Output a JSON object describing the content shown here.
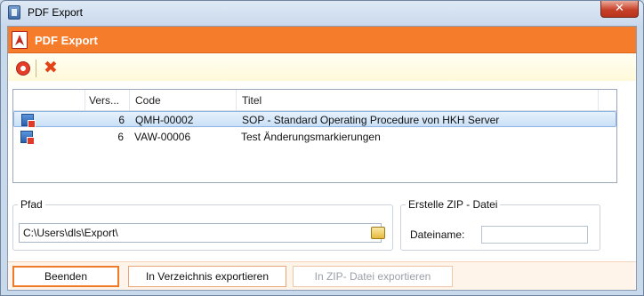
{
  "window": {
    "title": "PDF Export",
    "close_glyph": "✕"
  },
  "header": {
    "title": "PDF Export"
  },
  "toolbar": {
    "help_icon": "help-lifebuoy-icon",
    "cancel_icon": "red-x-icon",
    "cancel_glyph": "✖"
  },
  "grid": {
    "columns": [
      "Vers...",
      "Code",
      "Titel"
    ],
    "rows": [
      {
        "version": "6",
        "code": "QMH-00002",
        "title": "SOP - Standard Operating Procedure von HKH Server",
        "selected": true
      },
      {
        "version": "6",
        "code": "VAW-00006",
        "title": "Test Änderungsmarkierungen",
        "selected": false
      }
    ]
  },
  "pfad": {
    "legend": "Pfad",
    "value": "C:\\Users\\dls\\Export\\"
  },
  "zip": {
    "legend": "Erstelle ZIP - Datei",
    "dateiname_label": "Dateiname:",
    "dateiname_value": ""
  },
  "buttons": {
    "beenden": "Beenden",
    "export_dir": "In Verzeichnis exportieren",
    "export_zip": "In ZIP- Datei exportieren"
  },
  "colors": {
    "accent": "#f47c2a",
    "selection": "#c9e0f7"
  }
}
